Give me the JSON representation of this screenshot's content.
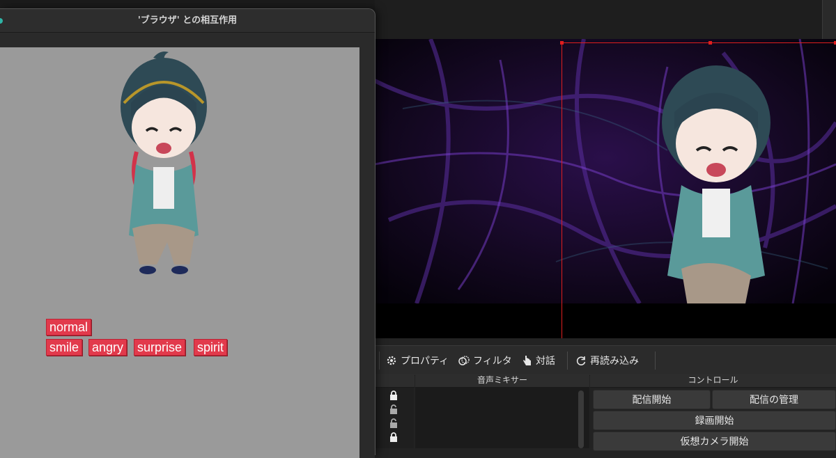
{
  "browser_window": {
    "title": "'ブラウザ' との相互作用",
    "expression_buttons": [
      {
        "id": "normal",
        "label": "normal"
      },
      {
        "id": "smile",
        "label": "smile"
      },
      {
        "id": "angry",
        "label": "angry"
      },
      {
        "id": "surprise",
        "label": "surprise"
      },
      {
        "id": "spirit",
        "label": "spirit"
      }
    ],
    "accent_color": "#e23a4c",
    "content_bg": "#9a9a9a"
  },
  "obs": {
    "selection_color": "#e01e1e",
    "toolbar": {
      "properties": {
        "label": "プロパティ",
        "icon": "gear-icon"
      },
      "filters": {
        "label": "フィルタ",
        "icon": "filter-icon"
      },
      "interact": {
        "label": "対話",
        "icon": "hand-pointer-icon"
      },
      "reload": {
        "label": "再読み込み",
        "icon": "refresh-icon"
      }
    },
    "docks": {
      "mixer_title": "音声ミキサー",
      "controls_title": "コントロール"
    },
    "controls": {
      "start_streaming": "配信開始",
      "manage_broadcast": "配信の管理",
      "start_recording": "録画開始",
      "start_virtual_camera": "仮想カメラ開始"
    }
  }
}
